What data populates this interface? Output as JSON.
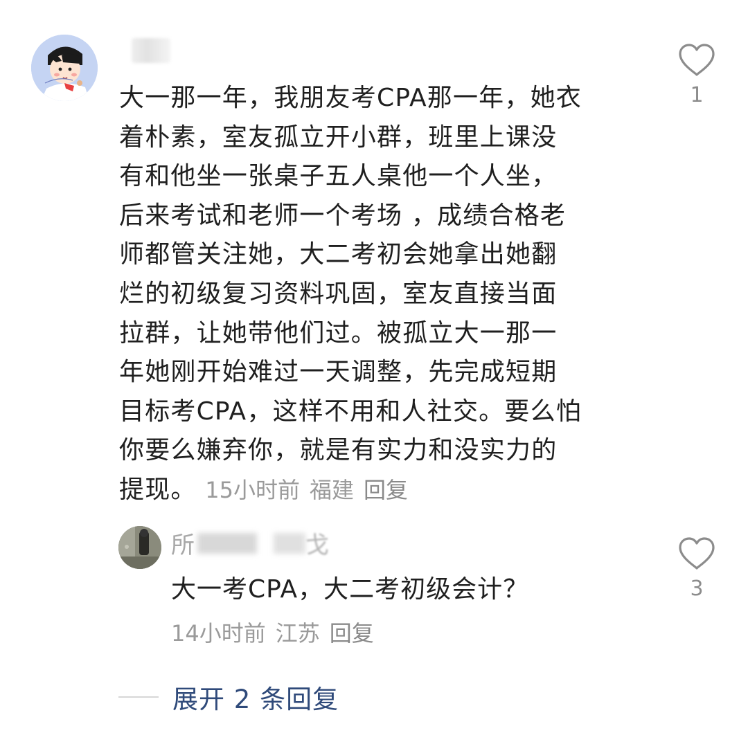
{
  "comment": {
    "lines": [
      "大一那一年，我朋友考CPA那一年，她衣",
      "着朴素，室友孤立开小群，班里上课没",
      "有和他坐一张桌子五人桌他一个人坐，",
      "后来考试和老师一个考场 ，成绩合格老",
      "师都管关注她，大二考初会她拿出她翻",
      "烂的初级复习资料巩固，室友直接当面",
      "拉群，让她带他们过。被孤立大一那一",
      "年她刚开始难过一天调整，先完成短期",
      "目标考CPA，这样不用和人社交。要么怕",
      "你要么嫌弃你，就是有实力和没实力的"
    ],
    "last_line": "提现。",
    "time": "15小时前",
    "location": "福建",
    "reply_label": "回复",
    "likes": "1"
  },
  "reply": {
    "name_prefix": "所",
    "name_suffix": "戈",
    "text": "大一考CPA，大二考初级会计？",
    "time": "14小时前",
    "location": "江苏",
    "reply_label": "回复",
    "likes": "3"
  },
  "expand": {
    "label": "展开 2 条回复"
  },
  "icons": {
    "like": "heart-outline-icon"
  },
  "colors": {
    "text": "#1f1f1f",
    "meta": "#9a9a9a",
    "link": "#2f4a7a",
    "icon": "#8c8c8c"
  }
}
